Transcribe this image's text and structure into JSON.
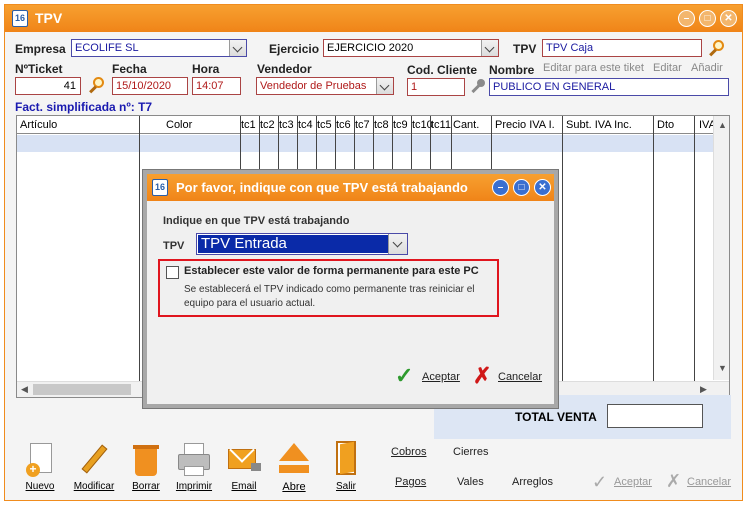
{
  "window": {
    "title": "TPV",
    "icon_text": "16"
  },
  "header": {
    "empresa_label": "Empresa",
    "empresa_value": "ECOLIFE SL",
    "ejercicio_label": "Ejercicio",
    "ejercicio_value": "EJERCICIO 2020",
    "tpv_label": "TPV",
    "tpv_value": "TPV Caja"
  },
  "ticket": {
    "nticket_label": "NºTicket",
    "nticket_value": "41",
    "fecha_label": "Fecha",
    "fecha_value": "15/10/2020",
    "hora_label": "Hora",
    "hora_value": "14:07",
    "vendedor_label": "Vendedor",
    "vendedor_value": "Vendedor de Pruebas",
    "codcliente_label": "Cod. Cliente",
    "codcliente_value": "1",
    "nombre_label": "Nombre",
    "nombre_value": "PUBLICO EN GENERAL",
    "editar_tiket": "Editar para este tiket",
    "editar": "Editar",
    "anadir": "Añadir"
  },
  "fact_label": "Fact. simplificada nº: T7",
  "grid": {
    "columns": [
      "Artículo",
      "Color",
      "tc1",
      "tc2",
      "tc3",
      "tc4",
      "tc5",
      "tc6",
      "tc7",
      "tc8",
      "tc9",
      "tc10",
      "tc11",
      "Cant.",
      "Precio IVA I.",
      "Subt. IVA Inc.",
      "Dto",
      "IVA"
    ]
  },
  "total": {
    "label": "TOTAL VENTA",
    "value": ""
  },
  "toolbar": {
    "nuevo": "Nuevo",
    "modificar": "Modificar",
    "borrar": "Borrar",
    "imprimir": "Imprimir",
    "email": "Email",
    "abre": "Abre",
    "salir": "Salir",
    "cobros": "Cobros",
    "cierres": "Cierres",
    "pagos": "Pagos",
    "vales": "Vales",
    "arreglos": "Arreglos",
    "aceptar": "Aceptar",
    "cancelar": "Cancelar"
  },
  "dialog": {
    "title": "Por favor, indique con que TPV está trabajando",
    "instruction": "Indique en que TPV está trabajando",
    "tpv_label": "TPV",
    "tpv_value": "TPV Entrada",
    "permanent_label": "Establecer este valor de forma permanente para este PC",
    "permanent_desc": "Se establecerá el TPV indicado como permanente tras reiniciar el equipo para el usuario actual.",
    "permanent_checked": false,
    "ok": "Aceptar",
    "cancel": "Cancelar"
  },
  "colors": {
    "accent": "#f08c1e",
    "dialog_highlight": "#e0151e",
    "selection": "#0a2aa8"
  }
}
